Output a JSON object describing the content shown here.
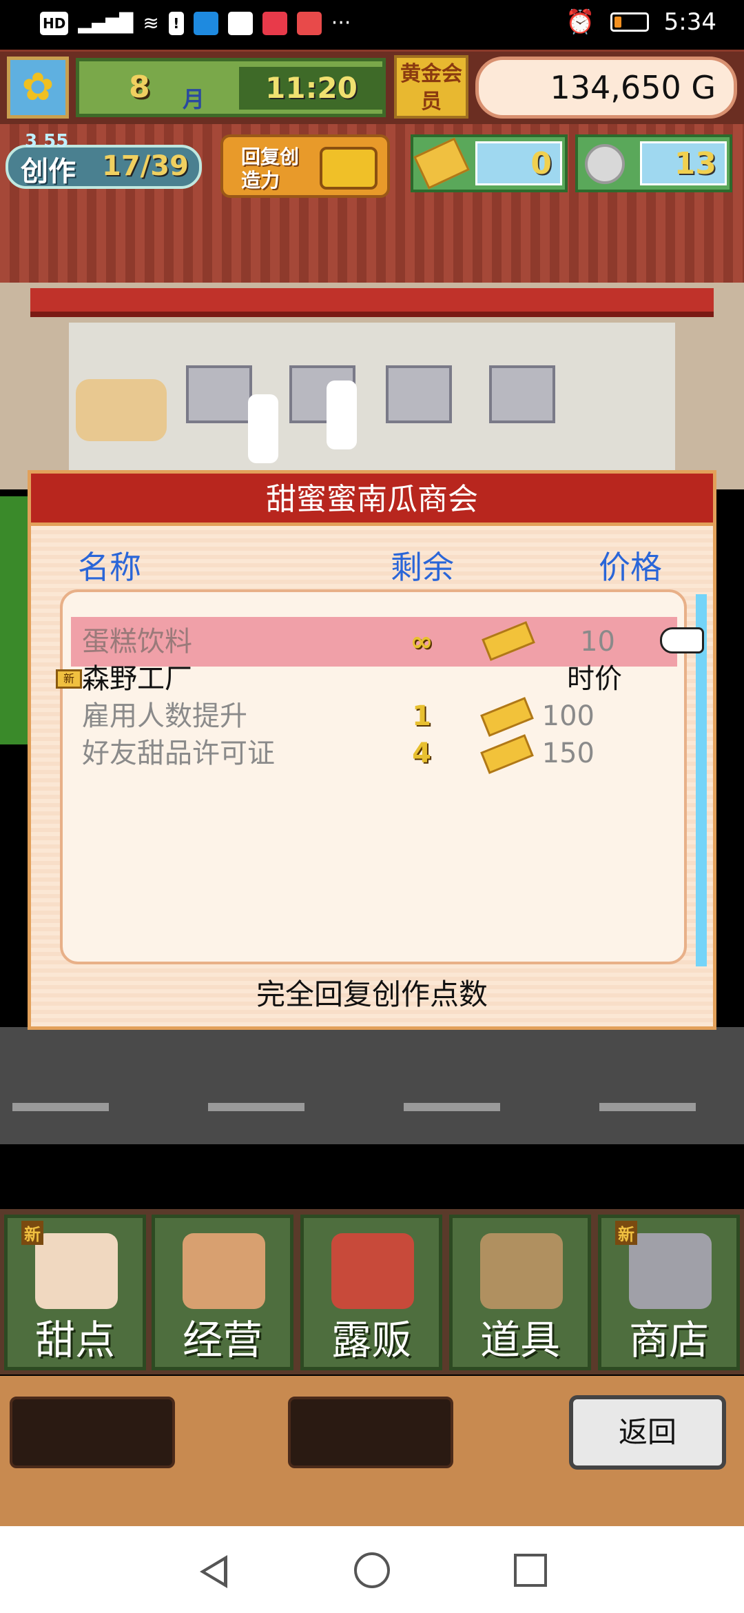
{
  "status_bar": {
    "left_icons": [
      "HD",
      "4G-signal-icon",
      "wifi-icon",
      "notification-icon",
      "app-icon",
      "app-icon",
      "app-icon",
      "app-icon"
    ],
    "more": "···",
    "time": "5:34",
    "battery_color": "#f39020"
  },
  "hud": {
    "month": "8",
    "month_unit": "月",
    "clock": "11:20",
    "gold_member": "黄金会员",
    "money": "134,650 G",
    "create_label": "创作",
    "create_level": "3 55",
    "create_count": "17/39",
    "restore_label": "回复创造力",
    "tickets": "0",
    "medals": "13"
  },
  "dialog": {
    "title": "甜蜜蜜南瓜商会",
    "columns": {
      "name": "名称",
      "remain": "剩余",
      "price": "价格"
    },
    "rows": [
      {
        "name": "蛋糕饮料",
        "remain": "∞",
        "price": "10"
      }
    ],
    "group": {
      "badge": "新",
      "name": "森野工厂",
      "price": "时价"
    },
    "group_rows": [
      {
        "name": "雇用人数提升",
        "remain": "1",
        "price": "100"
      },
      {
        "name": "好友甜品许可证",
        "remain": "4",
        "price": "150"
      }
    ],
    "footer": "完全回复创作点数"
  },
  "menu": {
    "items": [
      {
        "label": "甜点",
        "badge": "新"
      },
      {
        "label": "经营",
        "badge": ""
      },
      {
        "label": "露贩",
        "badge": ""
      },
      {
        "label": "道具",
        "badge": ""
      },
      {
        "label": "商店",
        "badge": "新"
      }
    ],
    "back": "返回"
  },
  "colors": {
    "header_red": "#b8261e",
    "column_blue": "#2a66d8",
    "selected_row": "#f0a0a8",
    "scrollbar": "#74d4f8"
  }
}
